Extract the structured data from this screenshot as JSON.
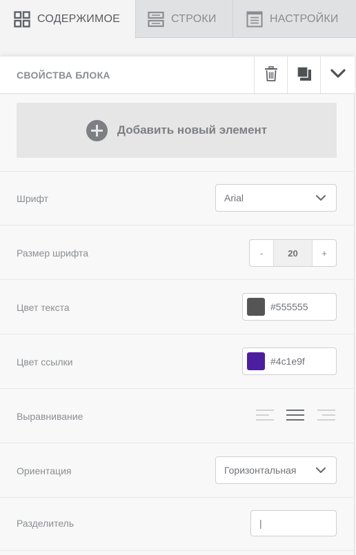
{
  "tabs": [
    {
      "label": "СОДЕРЖИМОЕ",
      "icon": "grid-icon",
      "active": true
    },
    {
      "label": "СТРОКИ",
      "icon": "rows-icon",
      "active": false
    },
    {
      "label": "НАСТРОЙКИ",
      "icon": "settings-panel-icon",
      "active": false
    }
  ],
  "panel": {
    "title": "СВОЙСТВА БЛОКА",
    "actions": [
      "trash-icon",
      "duplicate-icon",
      "chevron-down-icon"
    ]
  },
  "add_element": {
    "label": "Добавить новый элемент",
    "icon": "plus-circle-icon"
  },
  "properties": {
    "font": {
      "label": "Шрифт",
      "value": "Arial"
    },
    "font_size": {
      "label": "Размер шрифта",
      "value": "20",
      "minus": "-",
      "plus": "+"
    },
    "text_color": {
      "label": "Цвет текста",
      "value": "#555555",
      "color": "#555555"
    },
    "link_color": {
      "label": "Цвет ссылки",
      "value": "#4c1e9f",
      "color": "#4c1e9f"
    },
    "alignment": {
      "label": "Выравнивание",
      "options": [
        "left",
        "center",
        "right"
      ],
      "selected": "center"
    },
    "orientation": {
      "label": "Ориентация",
      "value": "Горизонтальная"
    },
    "separator": {
      "label": "Разделитель",
      "value": "|"
    }
  }
}
